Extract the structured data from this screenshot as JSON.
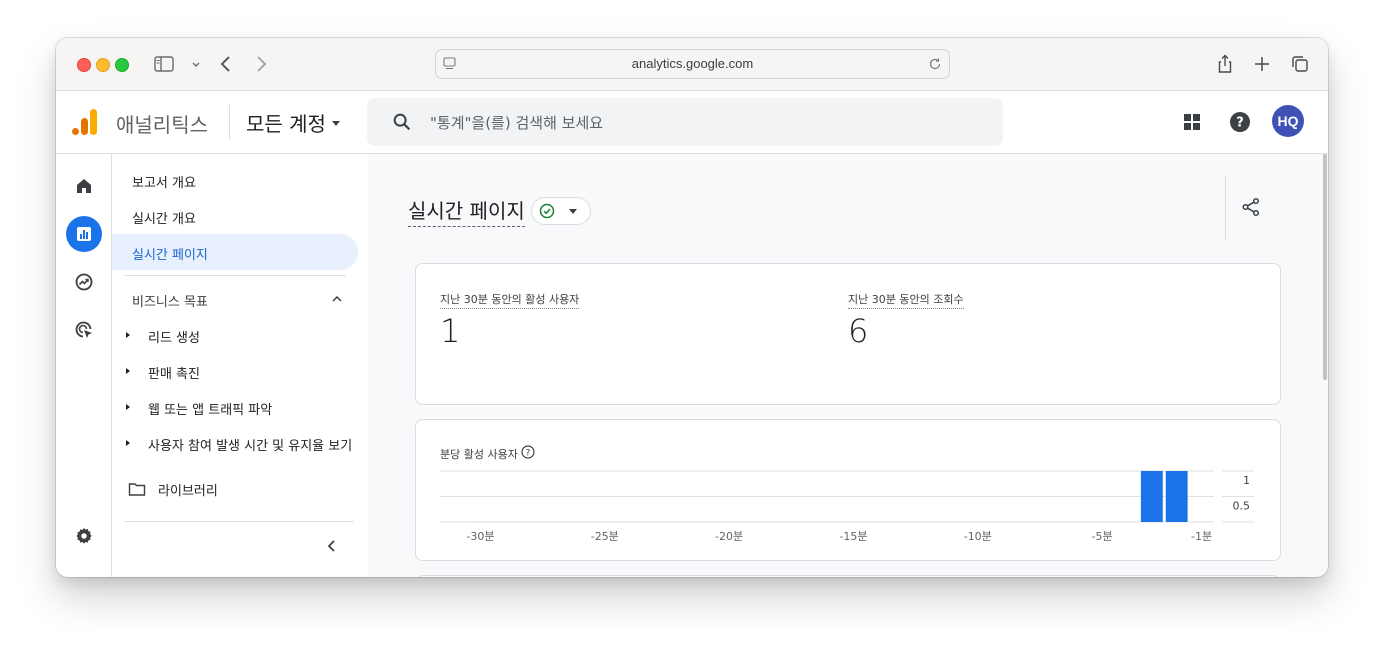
{
  "browser": {
    "url": "analytics.google.com"
  },
  "header": {
    "product_name": "애널리틱스",
    "account_selector": "모든 계정",
    "search_placeholder": "\"통계\"을(를) 검색해 보세요",
    "avatar_initials": "HQ"
  },
  "rail": {
    "items": [
      "home-icon",
      "reports-icon",
      "explore-icon",
      "advertising-icon"
    ],
    "bottom": "settings-icon"
  },
  "nav": {
    "items": [
      "보고서 개요",
      "실시간 개요",
      "실시간 페이지"
    ],
    "section_title": "비즈니스 목표",
    "section_items": [
      "리드 생성",
      "판매 촉진",
      "웹 또는 앱 트래픽 파악",
      "사용자 참여 발생 시간 및 유지율 보기"
    ],
    "library": "라이브러리",
    "active_index": 2
  },
  "main": {
    "page_title": "실시간 페이지",
    "metrics": [
      {
        "label": "지난 30분 동안의 활성 사용자",
        "value": "1"
      },
      {
        "label": "지난 30분 동안의 조회수",
        "value": "6"
      }
    ],
    "chart_title": "분당 활성 사용자",
    "colors": {
      "accent": "#1a73e8",
      "status_ok": "#188038"
    }
  },
  "chart_data": {
    "type": "bar",
    "title": "분당 활성 사용자",
    "x": [
      -30,
      -29,
      -28,
      -27,
      -26,
      -25,
      -24,
      -23,
      -22,
      -21,
      -20,
      -19,
      -18,
      -17,
      -16,
      -15,
      -14,
      -13,
      -12,
      -11,
      -10,
      -9,
      -8,
      -7,
      -6,
      -5,
      -4,
      -3,
      -2,
      -1
    ],
    "values": [
      0,
      0,
      0,
      0,
      0,
      0,
      0,
      0,
      0,
      0,
      0,
      0,
      0,
      0,
      0,
      0,
      0,
      0,
      0,
      0,
      0,
      0,
      0,
      0,
      0,
      0,
      0,
      1,
      1,
      0
    ],
    "x_tick_labels": [
      "-30분",
      "-25분",
      "-20분",
      "-15분",
      "-10분",
      "-5분",
      "-1분"
    ],
    "x_tick_values": [
      -30,
      -25,
      -20,
      -15,
      -10,
      -5,
      -1
    ],
    "y_tick_labels": [
      "1",
      "0.5"
    ],
    "ylim": [
      0,
      1
    ],
    "grid": true,
    "bar_color": "#1a73e8"
  }
}
